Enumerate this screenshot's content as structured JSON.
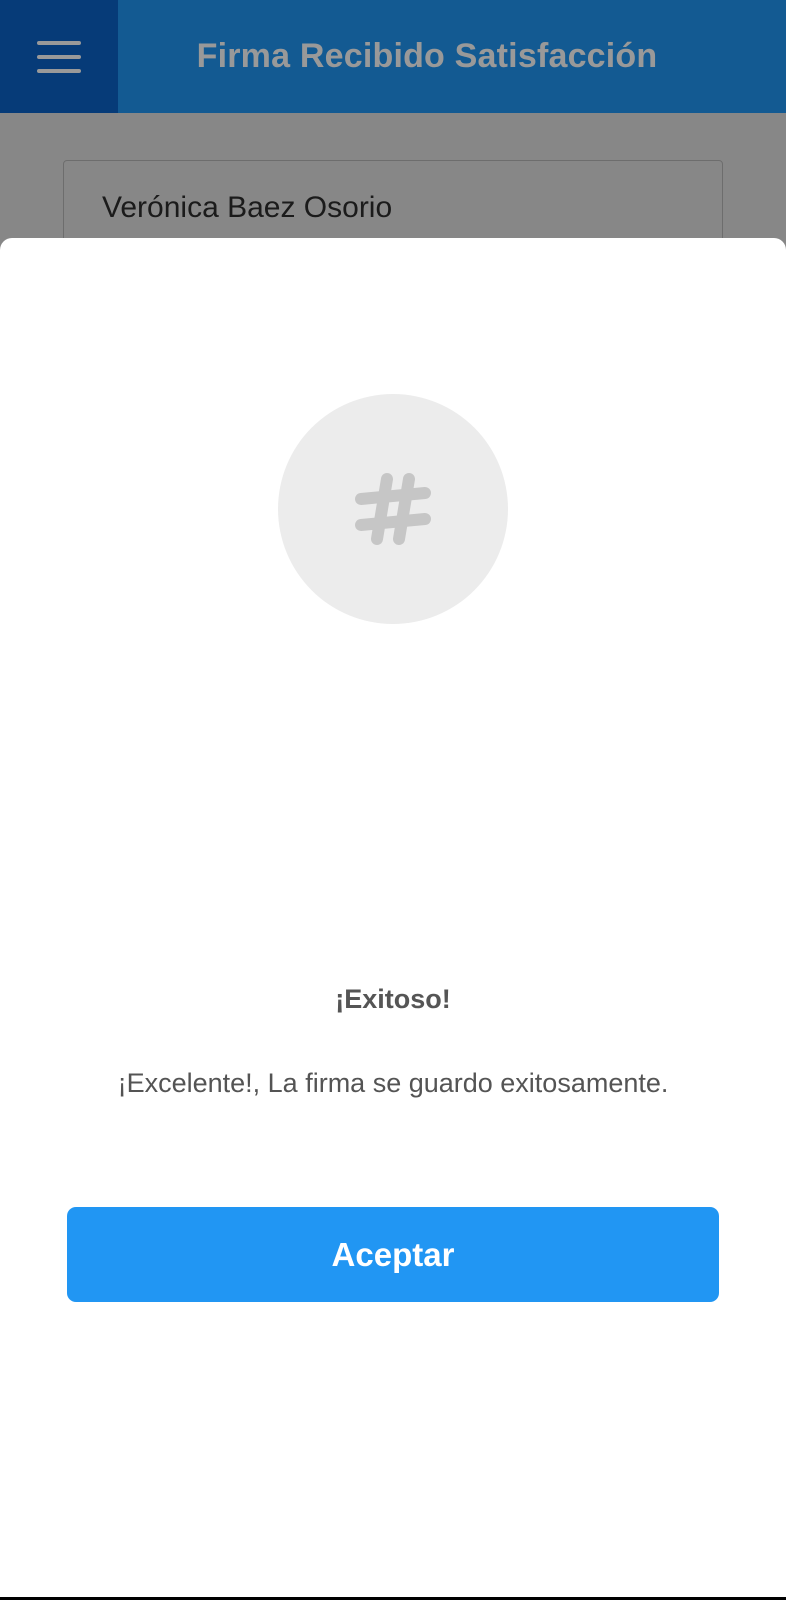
{
  "app_bar": {
    "title": "Firma Recibido Satisfacción",
    "menu_icon": "hamburger-menu-icon",
    "color": "#2196f3"
  },
  "form": {
    "name_value": "Verónica Baez Osorio"
  },
  "dialog": {
    "icon": "hashtag-icon",
    "title": "¡Exitoso!",
    "message": "¡Excelente!, La firma se guardo exitosamente.",
    "accept_label": "Aceptar",
    "accent_color": "#2196f3"
  }
}
